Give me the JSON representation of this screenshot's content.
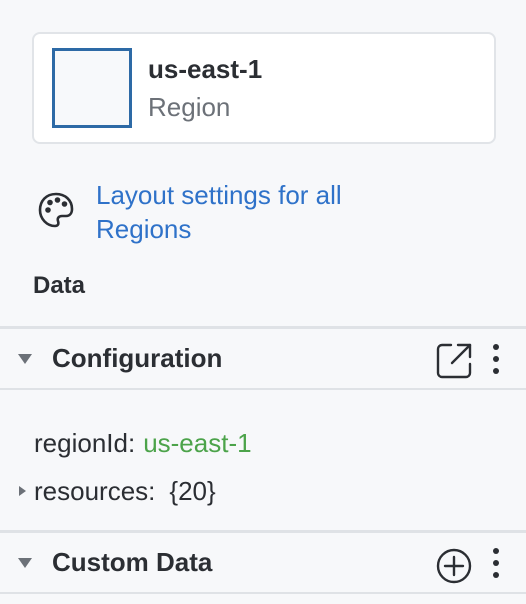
{
  "node": {
    "name": "us-east-1",
    "type": "Region",
    "swatch_color": "#2d6aa6"
  },
  "layout_link": {
    "text": "Layout settings for all Regions",
    "icon": "palette-icon"
  },
  "data_heading": "Data",
  "sections": {
    "configuration": {
      "title": "Configuration",
      "expanded": true,
      "action_icon": "open-external-icon",
      "menu_icon": "more-vertical-icon",
      "properties": [
        {
          "key": "regionId:",
          "value": "us-east-1",
          "expandable": false
        },
        {
          "key": "resources:",
          "value": "{20}",
          "expandable": true
        }
      ]
    },
    "custom_data": {
      "title": "Custom Data",
      "expanded": true,
      "action_icon": "add-circle-icon",
      "menu_icon": "more-vertical-icon"
    }
  },
  "colors": {
    "link": "#2f72c9",
    "string_value": "#4ca34a",
    "accent_border": "#2d6aa6"
  }
}
